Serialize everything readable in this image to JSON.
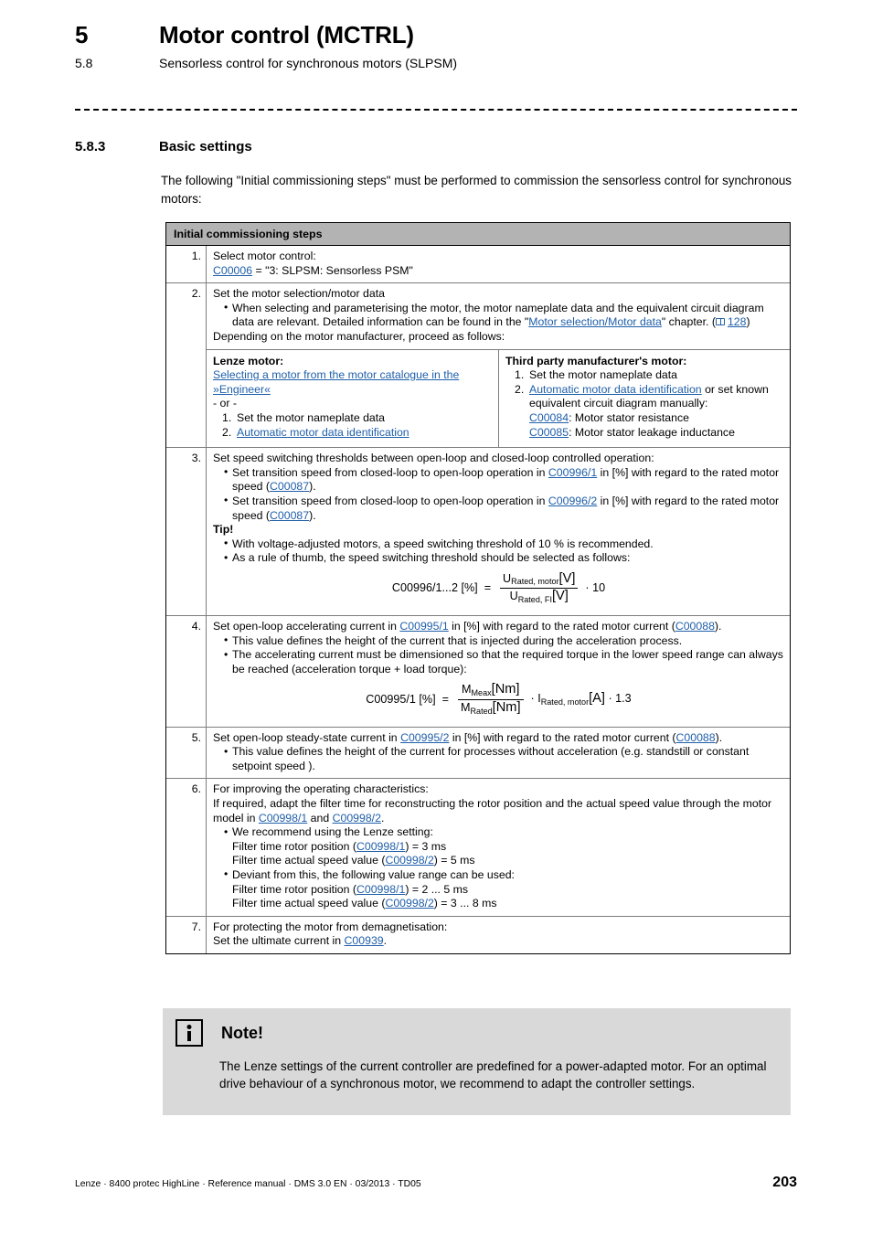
{
  "header": {
    "chapter_number": "5",
    "chapter_title": "Motor control (MCTRL)",
    "section_number": "5.8",
    "section_title": "Sensorless control for synchronous motors (SLPSM)"
  },
  "section": {
    "number": "5.8.3",
    "title": "Basic settings",
    "intro": "The following \"Initial commissioning steps\" must be performed to commission the sensorless control for synchronous motors:"
  },
  "table": {
    "header": "Initial commissioning steps",
    "rows": {
      "r1": {
        "num": "1.",
        "line1": "Select motor control:",
        "link": "C00006",
        "line2_rest": " = \"3: SLPSM: Sensorless PSM\""
      },
      "r2": {
        "num": "2.",
        "line1": "Set the motor selection/motor data",
        "bullet1_a": "When selecting and parameterising the motor, the motor nameplate data and the equivalent circuit diagram data are relevant. Detailed information can be found in the \"",
        "bullet1_link": "Motor selection/Motor data",
        "bullet1_b": "\" chapter. (",
        "bullet1_page": "128",
        "bullet1_c": ")",
        "line2": "Depending on the motor manufacturer, proceed as follows:",
        "left": {
          "title": "Lenze motor:",
          "link1": "Selecting a motor from the motor catalogue in the »Engineer«",
          "or": "- or -",
          "item1": "Set the motor nameplate data",
          "item2_link": "Automatic motor data identification"
        },
        "right": {
          "title": "Third party manufacturer's motor:",
          "item1": "Set the motor nameplate data",
          "item2_link": "Automatic motor data identification",
          "item2_rest": " or set known equivalent circuit diagram manually:",
          "c84_link": "C00084",
          "c84_text": ": Motor stator resistance",
          "c85_link": "C00085",
          "c85_text": ": Motor stator leakage inductance"
        }
      },
      "r3": {
        "num": "3.",
        "line1": "Set speed switching thresholds between open-loop and closed-loop controlled operation:",
        "b1_a": "Set transition speed from closed-loop to open-loop operation in ",
        "b1_link": "C00996/1",
        "b1_b": " in [%] with regard to the rated motor speed (",
        "b1_link2": "C00087",
        "b1_c": ").",
        "b2_a": "Set transition speed from closed-loop to open-loop operation in ",
        "b2_link": "C00996/2",
        "b2_b": " in [%] with regard to the rated motor speed (",
        "b2_link2": "C00087",
        "b2_c": ").",
        "tip_label": "Tip!",
        "tip1": "With voltage-adjusted motors, a speed switching threshold of 10 % is recommended.",
        "tip2": "As a rule of thumb, the speed switching threshold should be selected as follows:",
        "formula": {
          "lhs": "C00996/1...2 [%]",
          "eq": "=",
          "num_base": "U",
          "num_sub": "Rated, motor",
          "num_unit": "[V]",
          "den_base": "U",
          "den_sub": "Rated, FI",
          "den_unit": "[V]",
          "tail": "· 10"
        }
      },
      "r4": {
        "num": "4.",
        "line1_a": "Set open-loop accelerating current in ",
        "line1_link": "C00995/1",
        "line1_b": " in [%] with regard to the rated motor current (",
        "line1_link2": "C00088",
        "line1_c": ").",
        "b1": "This value defines the height of the current that is injected during the acceleration process.",
        "b2": "The accelerating current must be dimensioned so that the required torque in the lower speed range can always be reached (acceleration torque + load torque):",
        "formula": {
          "lhs": "C00995/1 [%]",
          "eq": "=",
          "num_base": "M",
          "num_sub": "Meax",
          "num_unit": "[Nm]",
          "den_base": "M",
          "den_sub": "Rated",
          "den_unit": "[Nm]",
          "tail_dot": "·",
          "tail_base": "I",
          "tail_sub": "Rated, motor",
          "tail_unit": "[A]",
          "tail_end": "· 1.3"
        }
      },
      "r5": {
        "num": "5.",
        "line1_a": "Set open-loop steady-state current in ",
        "line1_link": "C00995/2",
        "line1_b": " in [%] with regard to the rated motor current (",
        "line1_link2": "C00088",
        "line1_c": ").",
        "b1": "This value defines the height of the current for processes without acceleration (e.g. standstill or constant setpoint speed )."
      },
      "r6": {
        "num": "6.",
        "line1": "For improving the operating characteristics:",
        "line2_a": "If required, adapt the filter time for reconstructing the rotor position and the actual speed value through the motor model in ",
        "line2_link1": "C00998/1",
        "line2_and": " and ",
        "line2_link2": "C00998/2",
        "line2_b": ".",
        "b1": "We recommend using the Lenze setting:",
        "b1_l1_a": "Filter time rotor position (",
        "b1_l1_link": "C00998/1",
        "b1_l1_b": ") = 3 ms",
        "b1_l2_a": "Filter time actual speed value (",
        "b1_l2_link": "C00998/2",
        "b1_l2_b": ") = 5 ms",
        "b2": "Deviant from this, the following value range can be used:",
        "b2_l1_a": "Filter time rotor position (",
        "b2_l1_link": "C00998/1",
        "b2_l1_b": ") = 2 ... 5 ms",
        "b2_l2_a": "Filter time actual speed value (",
        "b2_l2_link": "C00998/2",
        "b2_l2_b": ") = 3 ... 8 ms"
      },
      "r7": {
        "num": "7.",
        "line1": "For protecting the motor from demagnetisation:",
        "line2_a": "Set the ultimate current in ",
        "line2_link": "C00939",
        "line2_b": "."
      }
    }
  },
  "note": {
    "icon": "info-icon",
    "title": "Note!",
    "body": "The Lenze settings of the current controller are predefined for a power-adapted motor. For an optimal drive behaviour of a synchronous motor, we recommend to adapt the controller settings."
  },
  "footer": {
    "text": "Lenze · 8400 protec HighLine · Reference manual · DMS 3.0 EN · 03/2013 · TD05",
    "page": "203"
  },
  "colors": {
    "link": "#1f5fa9",
    "table_header_bg": "#b3b3b3",
    "note_bg": "#d9d9d9"
  }
}
